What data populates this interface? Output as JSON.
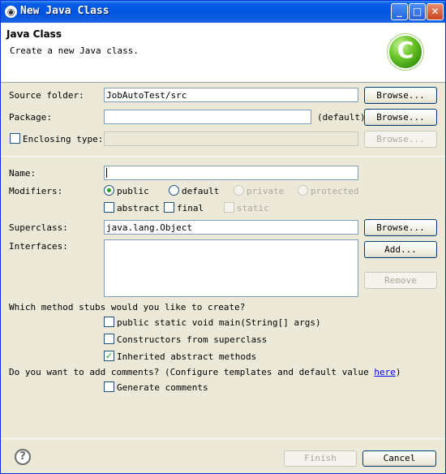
{
  "window": {
    "title": "New Java Class",
    "icon": "eclipse-icon",
    "min": "_",
    "max": "□",
    "close": "✕"
  },
  "header": {
    "title": "Java Class",
    "description": "Create a new Java class.",
    "logo_letter": "C"
  },
  "source_folder": {
    "label": "Source folder:",
    "value": "JobAutoTest/src",
    "browse": "Browse..."
  },
  "package": {
    "label": "Package:",
    "value": "",
    "suffix": "(default)",
    "browse": "Browse..."
  },
  "enclosing": {
    "label": "Enclosing type:",
    "checked": false,
    "value": "",
    "browse": "Browse..."
  },
  "name": {
    "label": "Name:",
    "value": ""
  },
  "modifiers": {
    "label": "Modifiers:",
    "public": "public",
    "default": "default",
    "private": "private",
    "protected": "protected",
    "abstract": "abstract",
    "final": "final",
    "static": "static",
    "selected": "public"
  },
  "superclass": {
    "label": "Superclass:",
    "value": "java.lang.Object",
    "browse": "Browse..."
  },
  "interfaces": {
    "label": "Interfaces:",
    "add": "Add...",
    "remove": "Remove"
  },
  "stubs": {
    "question": "Which method stubs would you like to create?",
    "main": "public static void main(String[] args)",
    "constructors": "Constructors from superclass",
    "inherited": "Inherited abstract methods",
    "main_checked": false,
    "constructors_checked": false,
    "inherited_checked": true
  },
  "comments": {
    "question_pre": "Do you want to add comments? (Configure templates and default value ",
    "link": "here",
    "question_post": ")",
    "generate": "Generate comments",
    "checked": false
  },
  "footer": {
    "help": "?",
    "finish": "Finish",
    "cancel": "Cancel"
  },
  "check_mark": "✓",
  "colors": {
    "title_bar": "#0055e5",
    "accent_check": "#21a121",
    "link": "#0000ff"
  }
}
